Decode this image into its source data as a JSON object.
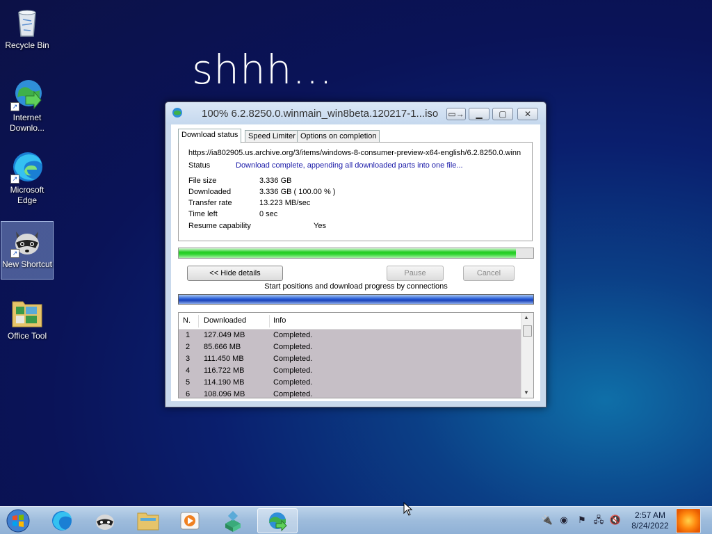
{
  "desktop": {
    "wallpaper_text": "shhh...",
    "icons": [
      {
        "label": "Recycle Bin"
      },
      {
        "label": "Internet Downlo..."
      },
      {
        "label": "Microsoft Edge"
      },
      {
        "label": "New Shortcut"
      },
      {
        "label": "Office Tool"
      }
    ]
  },
  "window": {
    "title": "100% 6.2.8250.0.winmain_win8beta.120217-1...iso",
    "tabs": [
      "Download status",
      "Speed Limiter",
      "Options on completion"
    ],
    "active_tab": "Download status",
    "url": "https://ia802905.us.archive.org/3/items/windows-8-consumer-preview-x64-english/6.2.8250.0.winn",
    "status_label": "Status",
    "status_value": "Download complete, appending all downloaded parts into one file...",
    "info": [
      {
        "label": "File size",
        "value": "3.336  GB"
      },
      {
        "label": "Downloaded",
        "value": "3.336  GB  ( 100.00 % )"
      },
      {
        "label": "Transfer rate",
        "value": "13.223  MB/sec"
      },
      {
        "label": "Time left",
        "value": "0 sec"
      },
      {
        "label": "Resume capability",
        "value": "Yes"
      }
    ],
    "progress_fraction": 0.95,
    "buttons": {
      "hide_details": "<< Hide details",
      "pause": "Pause",
      "cancel": "Cancel"
    },
    "connections_caption": "Start positions and download progress by connections",
    "list": {
      "headers": {
        "n": "N.",
        "downloaded": "Downloaded",
        "info": "Info"
      },
      "rows": [
        {
          "n": "1",
          "downloaded": "127.049  MB",
          "info": "Completed."
        },
        {
          "n": "2",
          "downloaded": "85.666  MB",
          "info": "Completed."
        },
        {
          "n": "3",
          "downloaded": "111.450  MB",
          "info": "Completed."
        },
        {
          "n": "4",
          "downloaded": "116.722  MB",
          "info": "Completed."
        },
        {
          "n": "5",
          "downloaded": "114.190  MB",
          "info": "Completed."
        },
        {
          "n": "6",
          "downloaded": "108.096  MB",
          "info": "Completed."
        }
      ]
    }
  },
  "taskbar": {
    "clock_time": "2:57 AM",
    "clock_date": "8/24/2022",
    "pinned": [
      "edge-icon",
      "raccoon-icon",
      "file-explorer-icon",
      "media-player-icon",
      "office-tool-icon",
      "idm-icon"
    ]
  }
}
